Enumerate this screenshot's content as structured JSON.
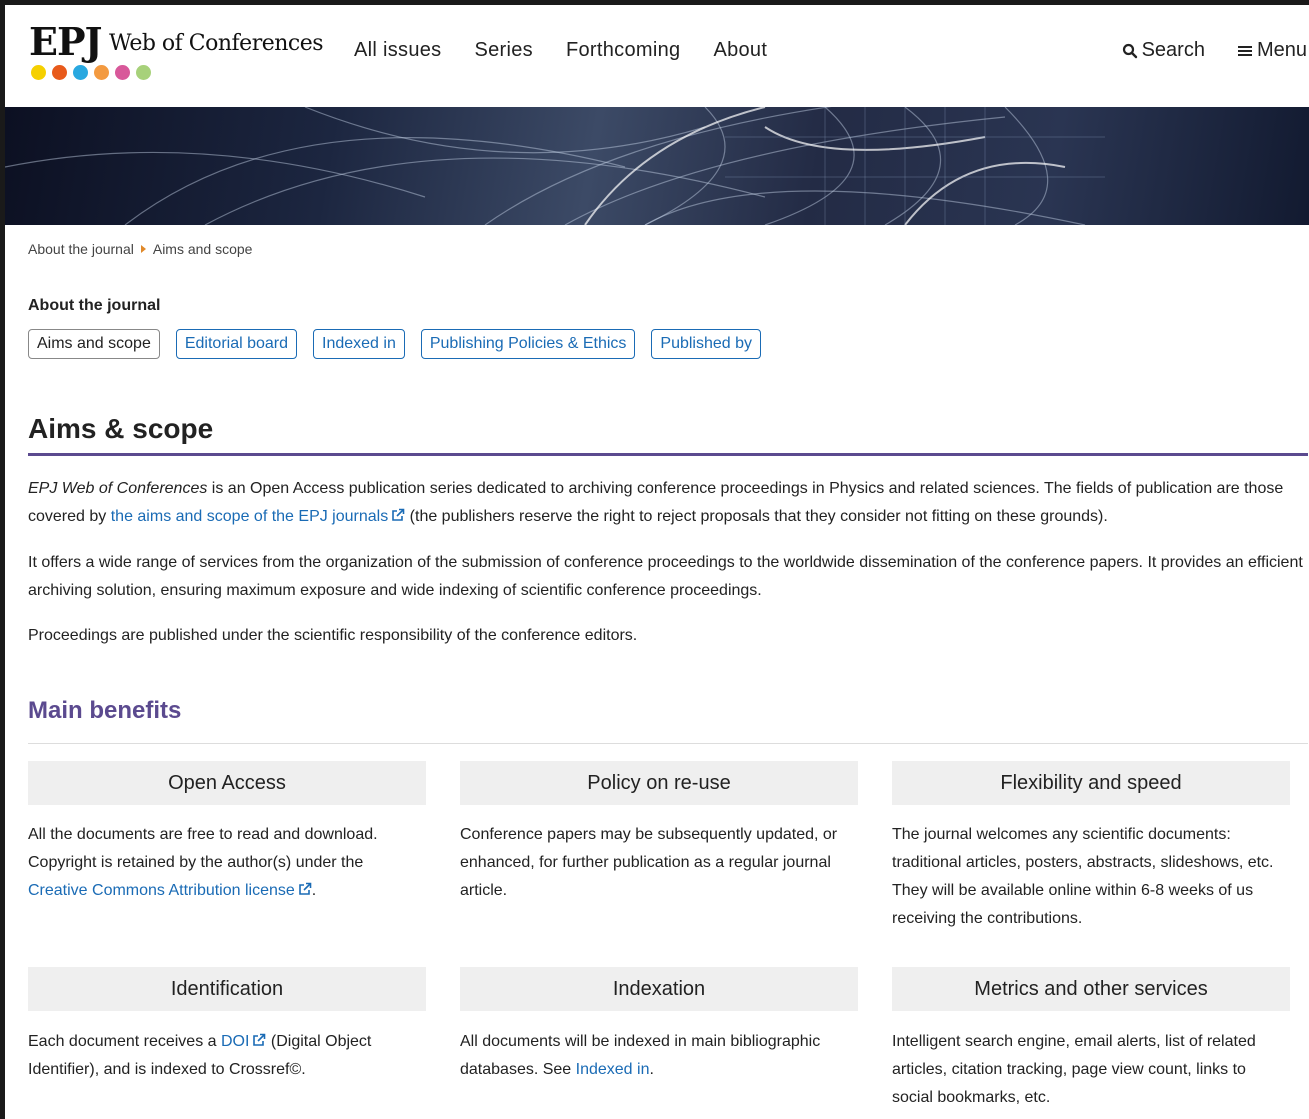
{
  "logo": {
    "epj": "EPJ",
    "name": "Web of Conferences",
    "dot_colors": [
      "#f5d000",
      "#e85a1b",
      "#29a8e0",
      "#f39a40",
      "#d8589a",
      "#a7d17a"
    ]
  },
  "nav": {
    "items": [
      "All issues",
      "Series",
      "Forthcoming",
      "About"
    ],
    "search_label": "Search",
    "menu_label": "Menu"
  },
  "breadcrumb": {
    "parent": "About the journal",
    "current": "Aims and scope"
  },
  "subnav": {
    "label": "About the journal",
    "tabs": [
      "Aims and scope",
      "Editorial board",
      "Indexed in",
      "Publishing Policies & Ethics",
      "Published by"
    ],
    "active_tab": "Aims and scope"
  },
  "content": {
    "title": "Aims & scope",
    "p1_italic": "EPJ Web of Conferences",
    "p1_a": " is an Open Access publication series dedicated to archiving conference proceedings in Physics and related sciences. The fields of publication are those covered by ",
    "p1_link": "the aims and scope of the EPJ journals",
    "p1_b": " (the publishers reserve the right to reject proposals that they consider not fitting on these grounds).",
    "p2": "It offers a wide range of services from the organization of the submission of conference proceedings to the worldwide dissemination of the conference papers. It provides an efficient archiving solution, ensuring maximum exposure and wide indexing of scientific conference proceedings.",
    "p3": "Proceedings are published under the scientific responsibility of the conference editors."
  },
  "benefits": {
    "title": "Main benefits",
    "open_access": {
      "title": "Open Access",
      "text": "All the documents are free to read and download. Copyright is retained by the author(s) under the ",
      "link": "Creative Commons Attribution license",
      "after": "."
    },
    "policy": {
      "title": "Policy on re-use",
      "text": "Conference papers may be subsequently updated, or enhanced, for further publication as a regular journal article."
    },
    "flexibility": {
      "title": "Flexibility and speed",
      "text": "The journal welcomes any scientific documents: traditional articles, posters, abstracts, slideshows, etc. They will be available online within 6-8 weeks of us receiving the contributions."
    },
    "identification": {
      "title": "Identification",
      "text_a": "Each document receives a ",
      "link": "DOI",
      "text_b": " (Digital Object Identifier), and is indexed to Crossref©."
    },
    "indexation": {
      "title": "Indexation",
      "text_a": "All documents will be indexed in main bibliographic databases. See ",
      "link": "Indexed in",
      "text_b": "."
    },
    "metrics": {
      "title": "Metrics and other services",
      "text": "Intelligent search engine, email alerts, list of related articles, citation tracking, page view count, links to social bookmarks, etc."
    }
  },
  "colors": {
    "accent": "#5b4a8f",
    "link": "#1a6bb5",
    "breadcrumb_arrow": "#e0892a"
  }
}
